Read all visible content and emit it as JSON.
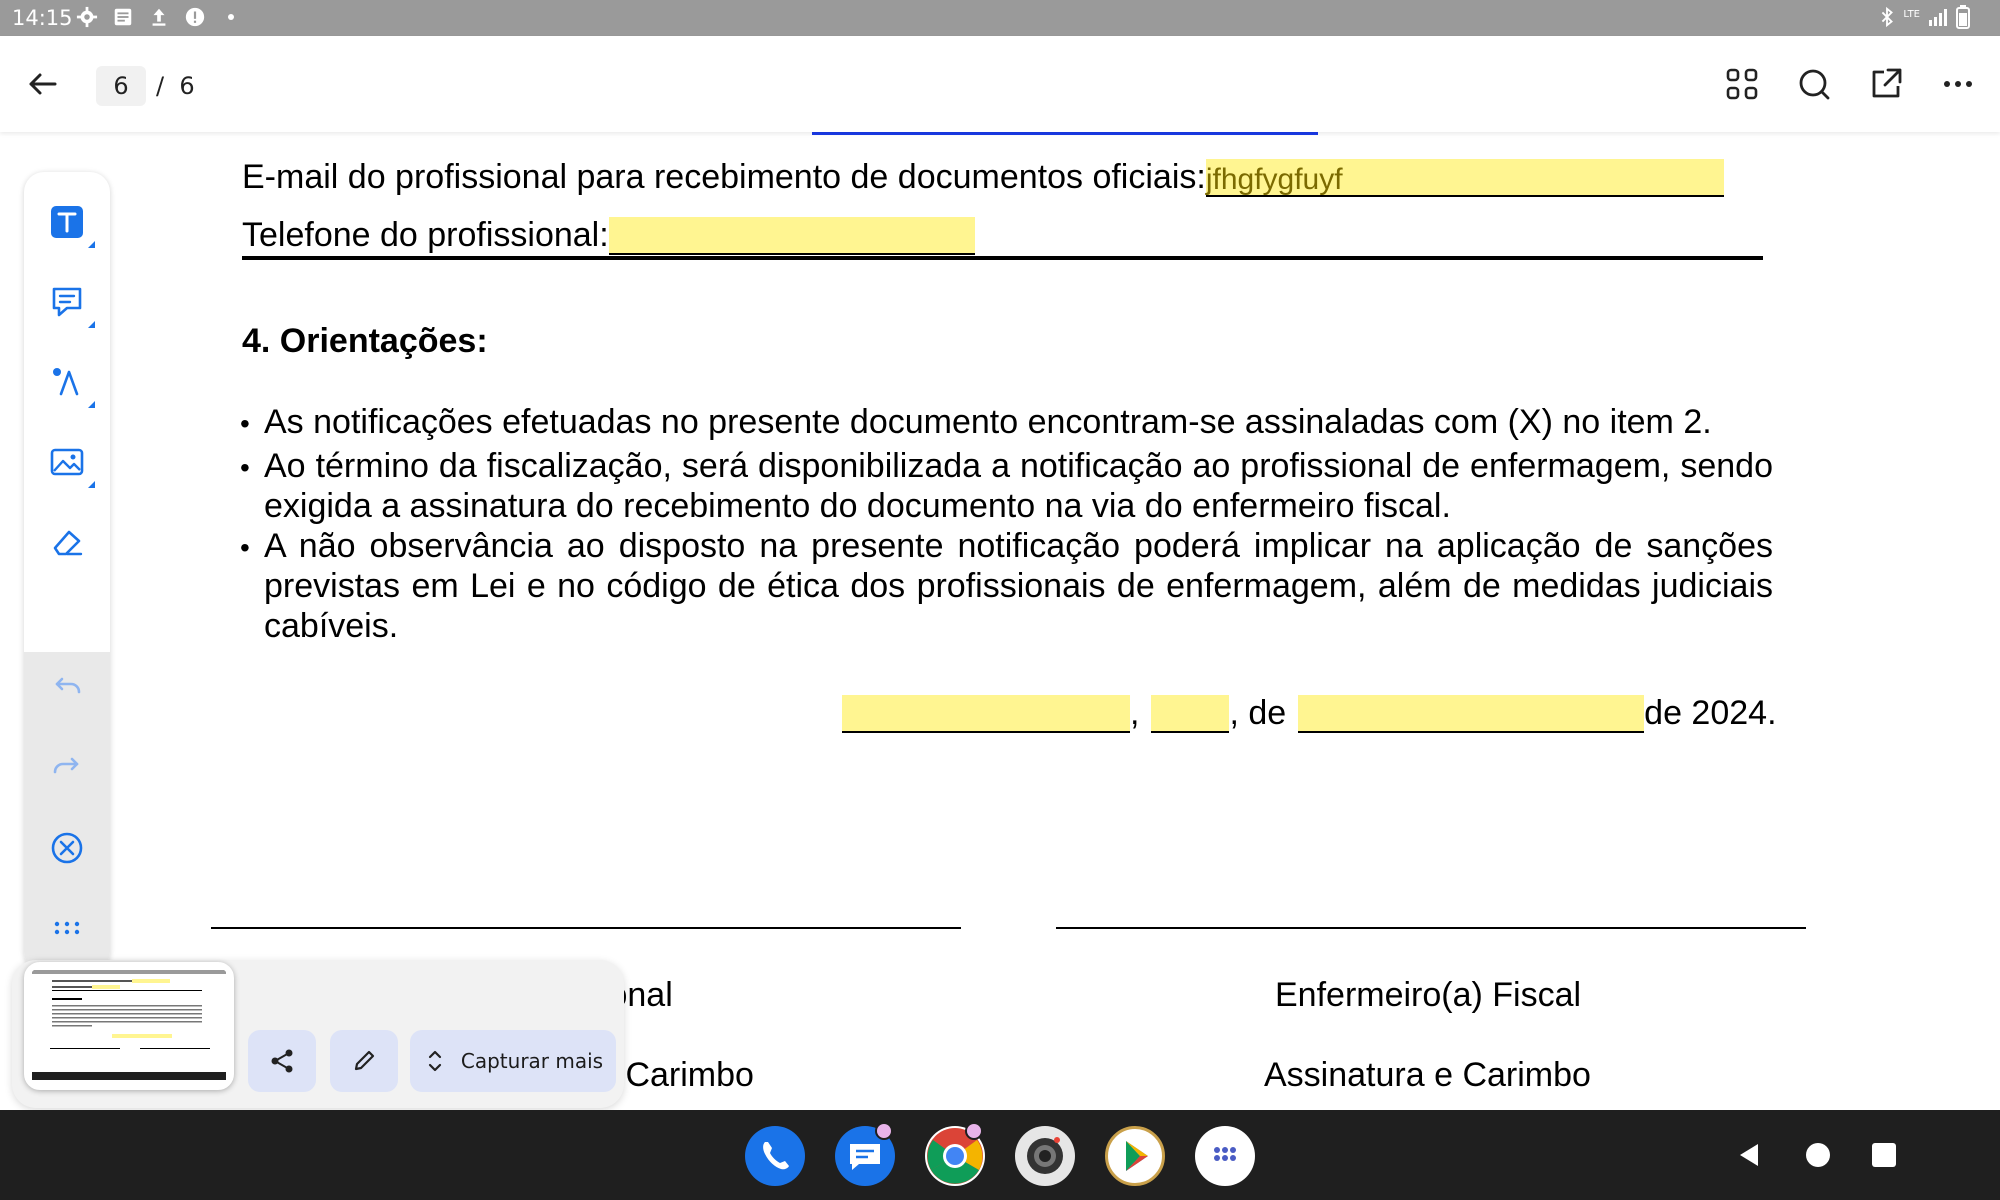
{
  "status_bar": {
    "time": "14:15",
    "network": "LTE"
  },
  "toolbar": {
    "current_page": "6",
    "page_separator": "/",
    "total_pages": "6"
  },
  "document": {
    "email_label": "E-mail do profissional para recebimento de documentos oficiais:",
    "email_value": "jfhgfygfuyf",
    "phone_label": "Telefone do profissional:",
    "phone_value": "",
    "section_heading": "4. Orientações:",
    "bullets": [
      "As notificações efetuadas no presente documento encontram-se assinaladas com (X) no item 2.",
      "Ao término da fiscalização, será disponibilizada a notificação ao profissional de enfermagem, sendo exigida a assinatura do recebimento do documento na via do enfermeiro fiscal.",
      "A não observância ao disposto na presente notificação poderá implicar na aplicação de sanções previstas em Lei e no código de ética dos profissionais de enfermagem, além de medidas judiciais cabíveis."
    ],
    "date_comma": ",",
    "date_de": ", de",
    "date_year": "de 2024.",
    "signatures": {
      "left_title": "Profissional",
      "left_sub": "Assinatura e Carimbo",
      "right_title": "Enfermeiro(a) Fiscal",
      "right_sub": "Assinatura e Carimbo"
    }
  },
  "annotation_tools": [
    "text-tool",
    "comment-tool",
    "ink-tool",
    "image-tool",
    "eraser-tool",
    "undo",
    "redo",
    "close",
    "more"
  ],
  "screenshot_preview": {
    "capture_more_label": "Capturar mais"
  },
  "accent_color": "#1a73e8",
  "highlight_color": "#fff591"
}
